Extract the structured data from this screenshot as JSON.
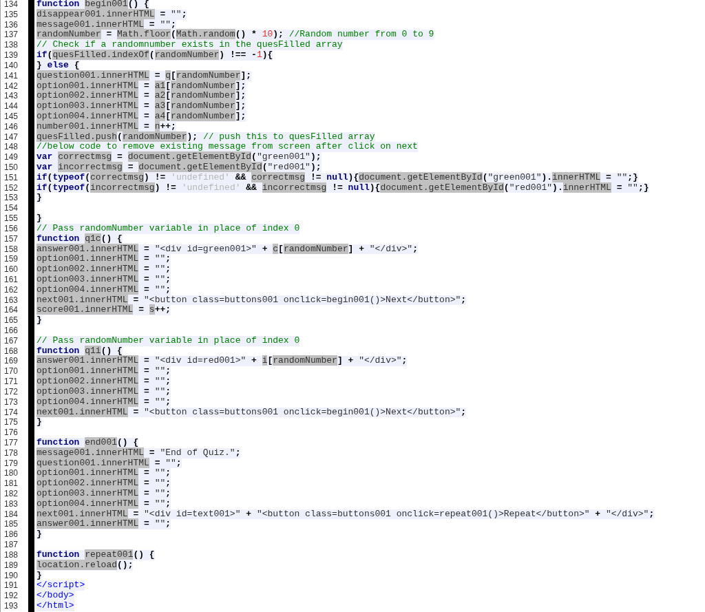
{
  "editor": {
    "lines": [
      {
        "number": "134",
        "tokens": [
          {
            "kind": "keyword",
            "text": "function "
          },
          {
            "kind": "ident",
            "text": "begin001"
          },
          {
            "kind": "op",
            "text": "() {"
          }
        ]
      },
      {
        "number": "135",
        "tokens": [
          {
            "kind": "ident",
            "text": "disappear001.innerHTML"
          },
          {
            "kind": "op",
            "text": " = "
          },
          {
            "kind": "string",
            "text": "\"\""
          },
          {
            "kind": "op",
            "text": ";"
          }
        ]
      },
      {
        "number": "136",
        "tokens": [
          {
            "kind": "ident",
            "text": "message001.innerHTML"
          },
          {
            "kind": "op",
            "text": " = "
          },
          {
            "kind": "string",
            "text": "\"\""
          },
          {
            "kind": "op",
            "text": ";"
          }
        ]
      },
      {
        "number": "137",
        "tokens": [
          {
            "kind": "ident",
            "text": "randomNumber"
          },
          {
            "kind": "op",
            "text": " = "
          },
          {
            "kind": "ident",
            "text": "Math.floor"
          },
          {
            "kind": "op",
            "text": "("
          },
          {
            "kind": "ident",
            "text": "Math.random"
          },
          {
            "kind": "op",
            "text": "() * "
          },
          {
            "kind": "number",
            "text": "10"
          },
          {
            "kind": "op",
            "text": "); "
          },
          {
            "kind": "comment",
            "text": "//Random number from 0 to 9"
          }
        ]
      },
      {
        "number": "138",
        "tokens": [
          {
            "kind": "comment",
            "text": "// Check if a randomnumber exists in the quesFilled array"
          }
        ]
      },
      {
        "number": "139",
        "tokens": [
          {
            "kind": "keyword",
            "text": "if"
          },
          {
            "kind": "op",
            "text": "("
          },
          {
            "kind": "ident",
            "text": "quesFilled.indexOf"
          },
          {
            "kind": "op",
            "text": "("
          },
          {
            "kind": "ident",
            "text": "randomNumber"
          },
          {
            "kind": "op",
            "text": ") !== -"
          },
          {
            "kind": "number",
            "text": "1"
          },
          {
            "kind": "op",
            "text": "){"
          }
        ]
      },
      {
        "number": "140",
        "tokens": [
          {
            "kind": "op",
            "text": "} "
          },
          {
            "kind": "keyword",
            "text": "else"
          },
          {
            "kind": "op",
            "text": " {"
          }
        ]
      },
      {
        "number": "141",
        "tokens": [
          {
            "kind": "ident",
            "text": "question001.innerHTML"
          },
          {
            "kind": "op",
            "text": " = "
          },
          {
            "kind": "ident",
            "text": "q"
          },
          {
            "kind": "op",
            "text": "["
          },
          {
            "kind": "ident",
            "text": "randomNumber"
          },
          {
            "kind": "op",
            "text": "];"
          }
        ]
      },
      {
        "number": "142",
        "tokens": [
          {
            "kind": "ident",
            "text": "option001.innerHTML"
          },
          {
            "kind": "op",
            "text": " = "
          },
          {
            "kind": "ident",
            "text": "a1"
          },
          {
            "kind": "op",
            "text": "["
          },
          {
            "kind": "ident",
            "text": "randomNumber"
          },
          {
            "kind": "op",
            "text": "];"
          }
        ]
      },
      {
        "number": "143",
        "tokens": [
          {
            "kind": "ident",
            "text": "option002.innerHTML"
          },
          {
            "kind": "op",
            "text": " = "
          },
          {
            "kind": "ident",
            "text": "a2"
          },
          {
            "kind": "op",
            "text": "["
          },
          {
            "kind": "ident",
            "text": "randomNumber"
          },
          {
            "kind": "op",
            "text": "];"
          }
        ]
      },
      {
        "number": "144",
        "tokens": [
          {
            "kind": "ident",
            "text": "option003.innerHTML"
          },
          {
            "kind": "op",
            "text": " = "
          },
          {
            "kind": "ident",
            "text": "a3"
          },
          {
            "kind": "op",
            "text": "["
          },
          {
            "kind": "ident",
            "text": "randomNumber"
          },
          {
            "kind": "op",
            "text": "];"
          }
        ]
      },
      {
        "number": "145",
        "tokens": [
          {
            "kind": "ident",
            "text": "option004.innerHTML"
          },
          {
            "kind": "op",
            "text": " = "
          },
          {
            "kind": "ident",
            "text": "a4"
          },
          {
            "kind": "op",
            "text": "["
          },
          {
            "kind": "ident",
            "text": "randomNumber"
          },
          {
            "kind": "op",
            "text": "];"
          }
        ]
      },
      {
        "number": "146",
        "tokens": [
          {
            "kind": "ident",
            "text": "number001.innerHTML"
          },
          {
            "kind": "op",
            "text": " = "
          },
          {
            "kind": "ident",
            "text": "n"
          },
          {
            "kind": "op",
            "text": "++;"
          }
        ]
      },
      {
        "number": "147",
        "tokens": [
          {
            "kind": "ident",
            "text": "quesFilled.push"
          },
          {
            "kind": "op",
            "text": "("
          },
          {
            "kind": "ident",
            "text": "randomNumber"
          },
          {
            "kind": "op",
            "text": "); "
          },
          {
            "kind": "comment",
            "text": "// push this to quesFilled array"
          }
        ]
      },
      {
        "number": "148",
        "tokens": [
          {
            "kind": "comment",
            "text": "//below code to remove existing message from screen after click on next"
          }
        ]
      },
      {
        "number": "149",
        "tokens": [
          {
            "kind": "keyword",
            "text": "var "
          },
          {
            "kind": "ident",
            "text": "correctmsg"
          },
          {
            "kind": "op",
            "text": " = "
          },
          {
            "kind": "ident",
            "text": "document.getElementById"
          },
          {
            "kind": "op",
            "text": "("
          },
          {
            "kind": "string",
            "text": "\"green001\""
          },
          {
            "kind": "op",
            "text": ");"
          }
        ]
      },
      {
        "number": "150",
        "tokens": [
          {
            "kind": "keyword",
            "text": "var "
          },
          {
            "kind": "ident",
            "text": "incorrectmsg"
          },
          {
            "kind": "op",
            "text": " = "
          },
          {
            "kind": "ident",
            "text": "document.getElementById"
          },
          {
            "kind": "op",
            "text": "("
          },
          {
            "kind": "string",
            "text": "\"red001\""
          },
          {
            "kind": "op",
            "text": ");"
          }
        ]
      },
      {
        "number": "151",
        "tokens": [
          {
            "kind": "keyword",
            "text": "if"
          },
          {
            "kind": "op",
            "text": "("
          },
          {
            "kind": "keyword",
            "text": "typeof"
          },
          {
            "kind": "op",
            "text": "("
          },
          {
            "kind": "ident",
            "text": "correctmsg"
          },
          {
            "kind": "op",
            "text": ") != "
          },
          {
            "kind": "quoted",
            "text": "'undefined'"
          },
          {
            "kind": "op",
            "text": " && "
          },
          {
            "kind": "ident",
            "text": "correctmsg"
          },
          {
            "kind": "op",
            "text": " != "
          },
          {
            "kind": "keyword",
            "text": "null"
          },
          {
            "kind": "op",
            "text": "){"
          },
          {
            "kind": "ident",
            "text": "document.getElementById"
          },
          {
            "kind": "op",
            "text": "("
          },
          {
            "kind": "string",
            "text": "\"green001\""
          },
          {
            "kind": "op",
            "text": ")."
          },
          {
            "kind": "ident",
            "text": "innerHTML"
          },
          {
            "kind": "op",
            "text": " = "
          },
          {
            "kind": "string",
            "text": "\"\""
          },
          {
            "kind": "op",
            "text": ";}"
          }
        ]
      },
      {
        "number": "152",
        "tokens": [
          {
            "kind": "keyword",
            "text": "if"
          },
          {
            "kind": "op",
            "text": "("
          },
          {
            "kind": "keyword",
            "text": "typeof"
          },
          {
            "kind": "op",
            "text": "("
          },
          {
            "kind": "ident",
            "text": "incorrectmsg"
          },
          {
            "kind": "op",
            "text": ") != "
          },
          {
            "kind": "quoted",
            "text": "'undefined'"
          },
          {
            "kind": "op",
            "text": " && "
          },
          {
            "kind": "ident",
            "text": "incorrectmsg"
          },
          {
            "kind": "op",
            "text": " != "
          },
          {
            "kind": "keyword",
            "text": "null"
          },
          {
            "kind": "op",
            "text": "){"
          },
          {
            "kind": "ident",
            "text": "document.getElementById"
          },
          {
            "kind": "op",
            "text": "("
          },
          {
            "kind": "string",
            "text": "\"red001\""
          },
          {
            "kind": "op",
            "text": ")."
          },
          {
            "kind": "ident",
            "text": "innerHTML"
          },
          {
            "kind": "op",
            "text": " = "
          },
          {
            "kind": "string",
            "text": "\"\""
          },
          {
            "kind": "op",
            "text": ";}"
          }
        ]
      },
      {
        "number": "153",
        "tokens": [
          {
            "kind": "op",
            "text": "}"
          }
        ]
      },
      {
        "number": "154"
      },
      {
        "number": "155",
        "tokens": [
          {
            "kind": "op",
            "text": "}"
          }
        ]
      },
      {
        "number": "156",
        "tokens": [
          {
            "kind": "comment",
            "text": "// Pass randomNumber variable in place of index 0"
          }
        ]
      },
      {
        "number": "157",
        "tokens": [
          {
            "kind": "keyword",
            "text": "function "
          },
          {
            "kind": "ident",
            "text": "q1c"
          },
          {
            "kind": "op",
            "text": "() {"
          }
        ]
      },
      {
        "number": "158",
        "tokens": [
          {
            "kind": "ident",
            "text": "answer001.innerHTML"
          },
          {
            "kind": "op",
            "text": " = "
          },
          {
            "kind": "string",
            "text": "\"<div id=green001>\""
          },
          {
            "kind": "op",
            "text": " + "
          },
          {
            "kind": "ident",
            "text": "c"
          },
          {
            "kind": "op",
            "text": "["
          },
          {
            "kind": "ident",
            "text": "randomNumber"
          },
          {
            "kind": "op",
            "text": "] + "
          },
          {
            "kind": "string",
            "text": "\"</div>\""
          },
          {
            "kind": "op",
            "text": ";"
          }
        ]
      },
      {
        "number": "159",
        "tokens": [
          {
            "kind": "ident",
            "text": "option001.innerHTML"
          },
          {
            "kind": "op",
            "text": " = "
          },
          {
            "kind": "string",
            "text": "\"\""
          },
          {
            "kind": "op",
            "text": ";"
          }
        ]
      },
      {
        "number": "160",
        "tokens": [
          {
            "kind": "ident",
            "text": "option002.innerHTML"
          },
          {
            "kind": "op",
            "text": " = "
          },
          {
            "kind": "string",
            "text": "\"\""
          },
          {
            "kind": "op",
            "text": ";"
          }
        ]
      },
      {
        "number": "161",
        "tokens": [
          {
            "kind": "ident",
            "text": "option003.innerHTML"
          },
          {
            "kind": "op",
            "text": " = "
          },
          {
            "kind": "string",
            "text": "\"\""
          },
          {
            "kind": "op",
            "text": ";"
          }
        ]
      },
      {
        "number": "162",
        "tokens": [
          {
            "kind": "ident",
            "text": "option004.innerHTML"
          },
          {
            "kind": "op",
            "text": " = "
          },
          {
            "kind": "string",
            "text": "\"\""
          },
          {
            "kind": "op",
            "text": ";"
          }
        ]
      },
      {
        "number": "163",
        "tokens": [
          {
            "kind": "ident",
            "text": "next001.innerHTML"
          },
          {
            "kind": "op",
            "text": " = "
          },
          {
            "kind": "string",
            "text": "\"<button class=buttons001 onclick=begin001()>Next</button>\""
          },
          {
            "kind": "op",
            "text": ";"
          }
        ]
      },
      {
        "number": "164",
        "tokens": [
          {
            "kind": "ident",
            "text": "score001.innerHTML"
          },
          {
            "kind": "op",
            "text": " = "
          },
          {
            "kind": "ident",
            "text": "s"
          },
          {
            "kind": "op",
            "text": "++;"
          }
        ]
      },
      {
        "number": "165",
        "tokens": [
          {
            "kind": "op",
            "text": "}"
          }
        ]
      },
      {
        "number": "166"
      },
      {
        "number": "167",
        "tokens": [
          {
            "kind": "comment",
            "text": "// Pass randomNumber variable in place of index 0"
          }
        ]
      },
      {
        "number": "168",
        "tokens": [
          {
            "kind": "keyword",
            "text": "function "
          },
          {
            "kind": "ident",
            "text": "q1i"
          },
          {
            "kind": "op",
            "text": "() {"
          }
        ]
      },
      {
        "number": "169",
        "tokens": [
          {
            "kind": "ident",
            "text": "answer001.innerHTML"
          },
          {
            "kind": "op",
            "text": " = "
          },
          {
            "kind": "string",
            "text": "\"<div id=red001>\""
          },
          {
            "kind": "op",
            "text": " + "
          },
          {
            "kind": "ident",
            "text": "i"
          },
          {
            "kind": "op",
            "text": "["
          },
          {
            "kind": "ident",
            "text": "randomNumber"
          },
          {
            "kind": "op",
            "text": "] + "
          },
          {
            "kind": "string",
            "text": "\"</div>\""
          },
          {
            "kind": "op",
            "text": ";"
          }
        ]
      },
      {
        "number": "170",
        "tokens": [
          {
            "kind": "ident",
            "text": "option001.innerHTML"
          },
          {
            "kind": "op",
            "text": " = "
          },
          {
            "kind": "string",
            "text": "\"\""
          },
          {
            "kind": "op",
            "text": ";"
          }
        ]
      },
      {
        "number": "171",
        "tokens": [
          {
            "kind": "ident",
            "text": "option002.innerHTML"
          },
          {
            "kind": "op",
            "text": " = "
          },
          {
            "kind": "string",
            "text": "\"\""
          },
          {
            "kind": "op",
            "text": ";"
          }
        ]
      },
      {
        "number": "172",
        "tokens": [
          {
            "kind": "ident",
            "text": "option003.innerHTML"
          },
          {
            "kind": "op",
            "text": " = "
          },
          {
            "kind": "string",
            "text": "\"\""
          },
          {
            "kind": "op",
            "text": ";"
          }
        ]
      },
      {
        "number": "173",
        "tokens": [
          {
            "kind": "ident",
            "text": "option004.innerHTML"
          },
          {
            "kind": "op",
            "text": " = "
          },
          {
            "kind": "string",
            "text": "\"\""
          },
          {
            "kind": "op",
            "text": ";"
          }
        ]
      },
      {
        "number": "174",
        "tokens": [
          {
            "kind": "ident",
            "text": "next001.innerHTML"
          },
          {
            "kind": "op",
            "text": " = "
          },
          {
            "kind": "string",
            "text": "\"<button class=buttons001 onclick=begin001()>Next</button>\""
          },
          {
            "kind": "op",
            "text": ";"
          }
        ]
      },
      {
        "number": "175",
        "tokens": [
          {
            "kind": "op",
            "text": "}"
          }
        ]
      },
      {
        "number": "176"
      },
      {
        "number": "177",
        "tokens": [
          {
            "kind": "keyword",
            "text": "function "
          },
          {
            "kind": "ident",
            "text": "end001"
          },
          {
            "kind": "op",
            "text": "() {"
          }
        ]
      },
      {
        "number": "178",
        "tokens": [
          {
            "kind": "ident",
            "text": "message001.innerHTML"
          },
          {
            "kind": "op",
            "text": " = "
          },
          {
            "kind": "string",
            "text": "\"End of Quiz.\""
          },
          {
            "kind": "op",
            "text": ";"
          }
        ]
      },
      {
        "number": "179",
        "tokens": [
          {
            "kind": "ident",
            "text": "question001.innerHTML"
          },
          {
            "kind": "op",
            "text": " = "
          },
          {
            "kind": "string",
            "text": "\"\""
          },
          {
            "kind": "op",
            "text": ";"
          }
        ]
      },
      {
        "number": "180",
        "tokens": [
          {
            "kind": "ident",
            "text": "option001.innerHTML"
          },
          {
            "kind": "op",
            "text": " = "
          },
          {
            "kind": "string",
            "text": "\"\""
          },
          {
            "kind": "op",
            "text": ";"
          }
        ]
      },
      {
        "number": "181",
        "tokens": [
          {
            "kind": "ident",
            "text": "option002.innerHTML"
          },
          {
            "kind": "op",
            "text": " = "
          },
          {
            "kind": "string",
            "text": "\"\""
          },
          {
            "kind": "op",
            "text": ";"
          }
        ]
      },
      {
        "number": "182",
        "tokens": [
          {
            "kind": "ident",
            "text": "option003.innerHTML"
          },
          {
            "kind": "op",
            "text": " = "
          },
          {
            "kind": "string",
            "text": "\"\""
          },
          {
            "kind": "op",
            "text": ";"
          }
        ]
      },
      {
        "number": "183",
        "tokens": [
          {
            "kind": "ident",
            "text": "option004.innerHTML"
          },
          {
            "kind": "op",
            "text": " = "
          },
          {
            "kind": "string",
            "text": "\"\""
          },
          {
            "kind": "op",
            "text": ";"
          }
        ]
      },
      {
        "number": "184",
        "tokens": [
          {
            "kind": "ident",
            "text": "next001.innerHTML"
          },
          {
            "kind": "op",
            "text": " = "
          },
          {
            "kind": "string",
            "text": "\"<div id=text001>\""
          },
          {
            "kind": "op",
            "text": " + "
          },
          {
            "kind": "string",
            "text": "\"<button class=buttons001 onclick=repeat001()>Repeat</button>\""
          },
          {
            "kind": "op",
            "text": " + "
          },
          {
            "kind": "string",
            "text": "\"</div>\""
          },
          {
            "kind": "op",
            "text": ";"
          }
        ]
      },
      {
        "number": "185",
        "tokens": [
          {
            "kind": "ident",
            "text": "answer001.innerHTML"
          },
          {
            "kind": "op",
            "text": " = "
          },
          {
            "kind": "string",
            "text": "\"\""
          },
          {
            "kind": "op",
            "text": ";"
          }
        ]
      },
      {
        "number": "186",
        "tokens": [
          {
            "kind": "op",
            "text": "}"
          }
        ]
      },
      {
        "number": "187"
      },
      {
        "number": "188",
        "tokens": [
          {
            "kind": "keyword",
            "text": "function "
          },
          {
            "kind": "ident",
            "text": "repeat001"
          },
          {
            "kind": "op",
            "text": "() {"
          }
        ]
      },
      {
        "number": "189",
        "tokens": [
          {
            "kind": "ident",
            "text": "location.reload"
          },
          {
            "kind": "op",
            "text": "();"
          }
        ]
      },
      {
        "number": "190",
        "tokens": [
          {
            "kind": "op",
            "text": "}"
          }
        ]
      },
      {
        "number": "191",
        "tokens": [
          {
            "kind": "tag",
            "text": "</script>"
          }
        ]
      },
      {
        "number": "192",
        "tokens": [
          {
            "kind": "tag",
            "text": "</body>"
          }
        ]
      },
      {
        "number": "193",
        "tokens": [
          {
            "kind": "tag",
            "text": "</html>"
          }
        ]
      }
    ]
  }
}
